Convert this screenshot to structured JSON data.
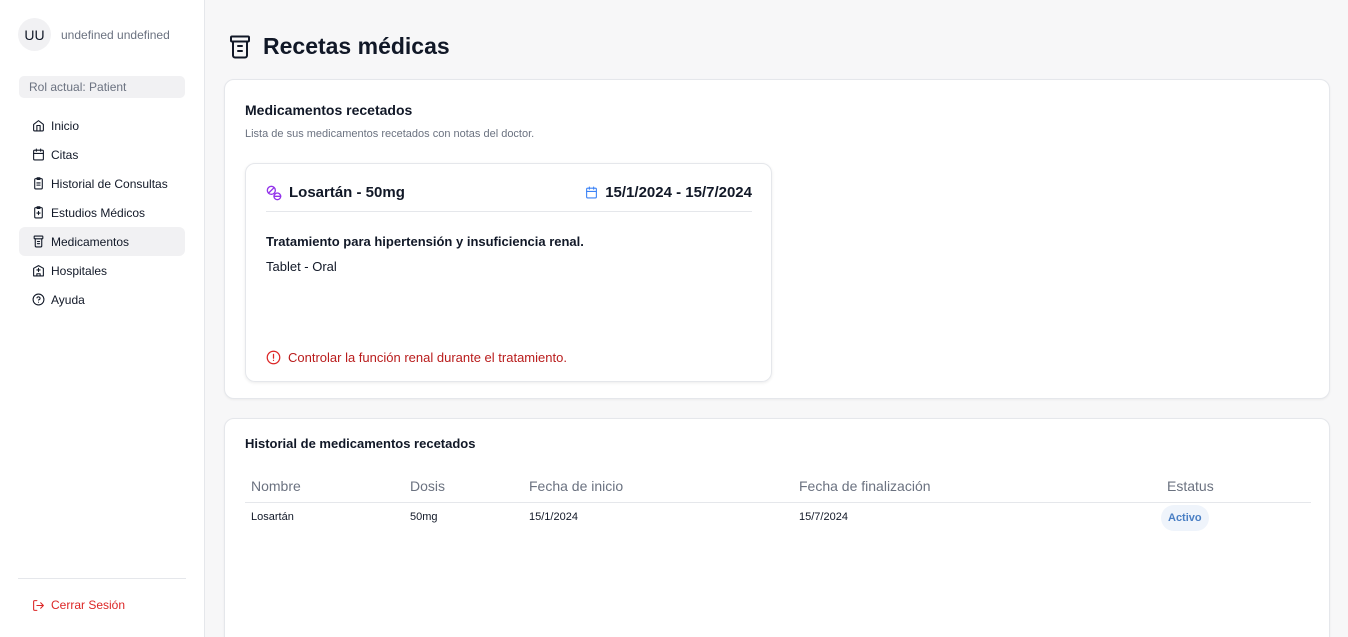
{
  "user": {
    "initials": "UU",
    "name": "undefined undefined"
  },
  "role_label": "Rol actual: Patient",
  "nav": [
    {
      "label": "Inicio",
      "icon": "home-icon"
    },
    {
      "label": "Citas",
      "icon": "calendar-icon"
    },
    {
      "label": "Historial de Consultas",
      "icon": "clipboard-icon"
    },
    {
      "label": "Estudios Médicos",
      "icon": "clipboard-plus-icon"
    },
    {
      "label": "Medicamentos",
      "icon": "pill-bottle-icon",
      "active": true
    },
    {
      "label": "Hospitales",
      "icon": "hospital-icon"
    },
    {
      "label": "Ayuda",
      "icon": "help-circle-icon"
    }
  ],
  "logout_label": "Cerrar Sesión",
  "page_title": "Recetas médicas",
  "prescribed": {
    "title": "Medicamentos recetados",
    "description": "Lista de sus medicamentos recetados con notas del doctor.",
    "card": {
      "name": "Losartán - 50mg",
      "dates": "15/1/2024 - 15/7/2024",
      "treatment": "Tratamiento para hipertensión y insuficiencia renal.",
      "form": "Tablet - Oral",
      "warning": "Controlar la función renal durante el tratamiento."
    }
  },
  "history": {
    "title": "Historial de medicamentos recetados",
    "columns": [
      "Nombre",
      "Dosis",
      "Fecha de inicio",
      "Fecha de finalización",
      "Estatus"
    ],
    "rows": [
      {
        "name": "Losartán",
        "dose": "50mg",
        "start": "15/1/2024",
        "end": "15/7/2024",
        "status": "Activo"
      }
    ]
  },
  "colors": {
    "accent_purple": "#9333ea",
    "accent_blue": "#3b82f6",
    "danger": "#dc2626",
    "badge_text": "#4a7fc4"
  }
}
